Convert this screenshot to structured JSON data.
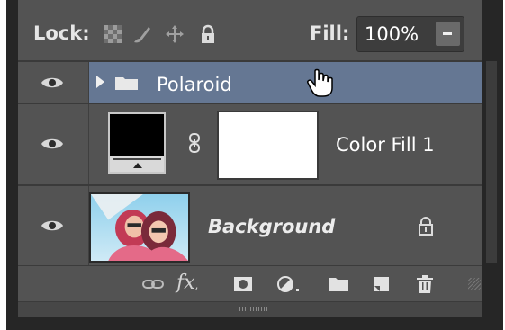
{
  "lock_row": {
    "label": "Lock:",
    "icons": [
      "lock-transparent-pixels-icon",
      "lock-image-pixels-icon",
      "lock-position-icon",
      "lock-all-icon"
    ],
    "fill_label": "Fill:",
    "fill_value": "100%"
  },
  "layers": [
    {
      "name": "Polaroid",
      "type": "group",
      "selected": true,
      "visible": true
    },
    {
      "name": "Color Fill 1",
      "type": "fill",
      "fill_color": "#000000",
      "mask": "white",
      "visible": true
    },
    {
      "name": "Background",
      "type": "image",
      "locked": true,
      "visible": true
    }
  ],
  "footer": {
    "fx_label": "fx",
    "icons": [
      "link-layers-icon",
      "fx-icon",
      "add-mask-icon",
      "adjustment-layer-icon",
      "new-group-icon",
      "new-layer-icon",
      "delete-layer-icon"
    ]
  },
  "colors": {
    "panel_bg": "#535353",
    "selected_row": "#657793",
    "border": "#262626"
  }
}
